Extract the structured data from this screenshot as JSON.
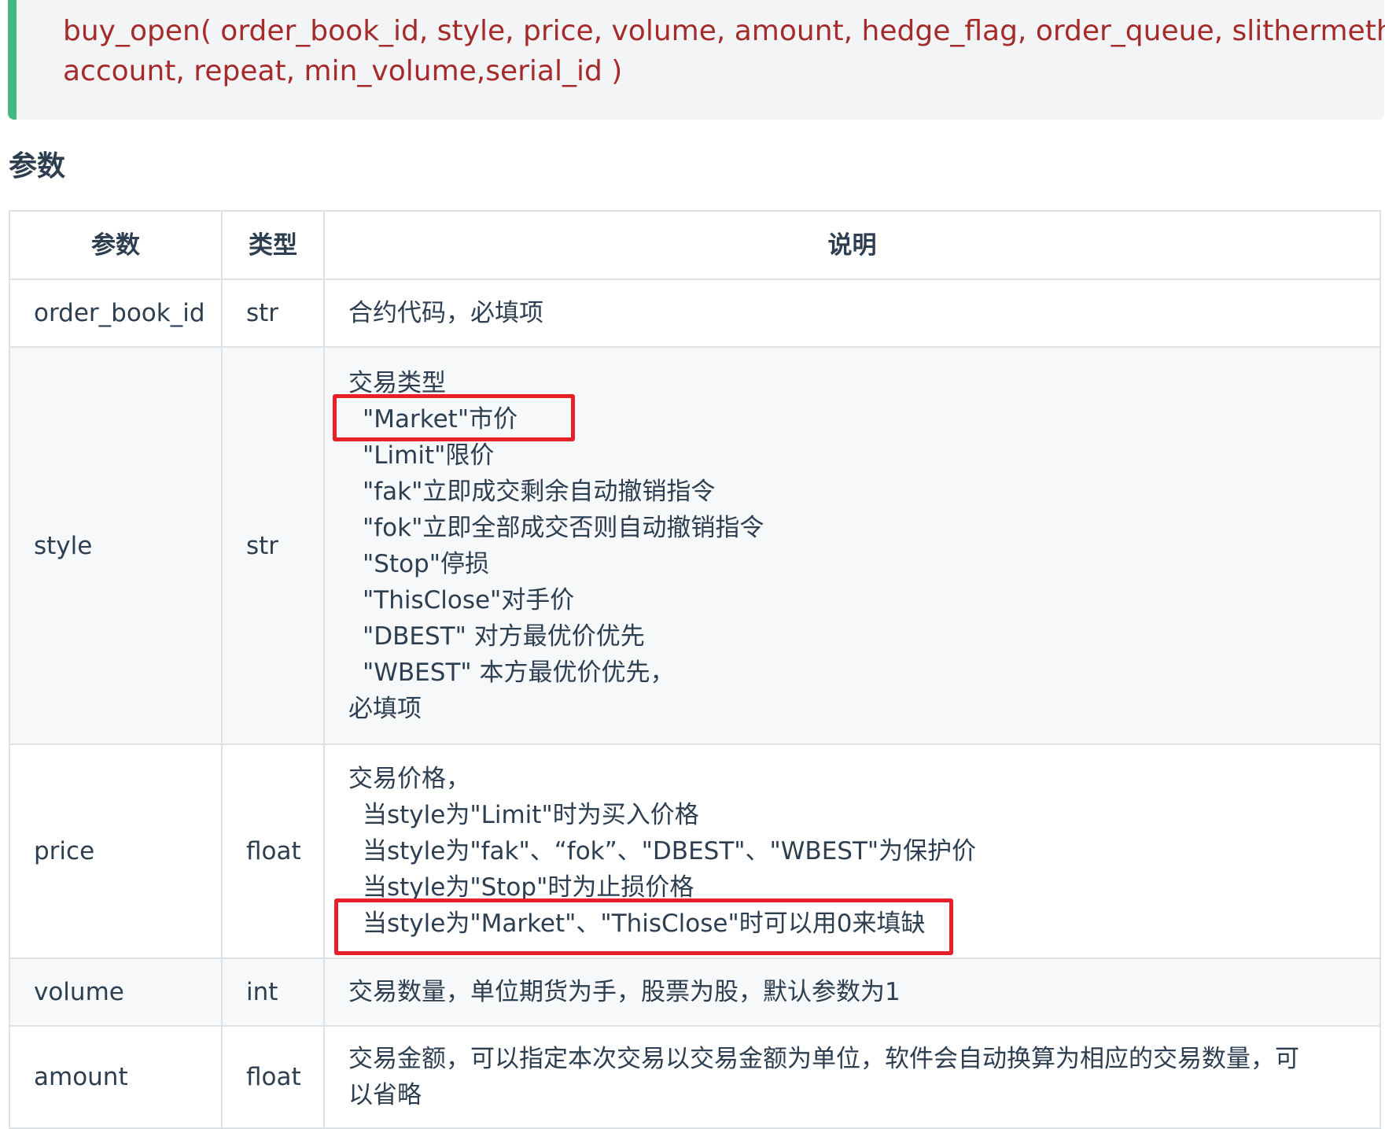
{
  "signature": {
    "line1": "buy_open( order_book_id, style, price, volume, amount, hedge_flag, order_queue, slithermethod,",
    "line2": "account, repeat, min_volume,serial_id )"
  },
  "section_title": "参数",
  "table": {
    "headers": [
      "参数",
      "类型",
      "说明"
    ],
    "rows": [
      {
        "name": "order_book_id",
        "type": "str",
        "desc": [
          "合约代码，必填项"
        ]
      },
      {
        "name": "style",
        "type": "str",
        "desc": [
          "交易类型",
          "\"Market\"市价",
          "\"Limit\"限价",
          "\"fak\"立即成交剩余自动撤销指令",
          "\"fok\"立即全部成交否则自动撤销指令",
          "\"Stop\"停损",
          "\"ThisClose\"对手价",
          "\"DBEST\" 对方最优价优先",
          "\"WBEST\" 本方最优价优先，",
          "必填项"
        ]
      },
      {
        "name": "price",
        "type": "float",
        "desc": [
          "交易价格，",
          "当style为\"Limit\"时为买入价格",
          "当style为\"fak\"、“fok”、\"DBEST\"、\"WBEST\"为保护价",
          "当style为\"Stop\"时为止损价格",
          "当style为\"Market\"、\"ThisClose\"时可以用0来填缺"
        ]
      },
      {
        "name": "volume",
        "type": "int",
        "desc": [
          "交易数量，单位期货为手，股票为股，默认参数为1"
        ]
      },
      {
        "name": "amount",
        "type": "float",
        "desc": [
          "交易金额，可以指定本次交易以交易金额为单位，软件会自动换算为相应的交易数量，可",
          "以省略"
        ]
      }
    ]
  },
  "colors": {
    "code_text": "#a52a2a",
    "accent_bar": "#42b983",
    "highlight": "#e8202a"
  }
}
